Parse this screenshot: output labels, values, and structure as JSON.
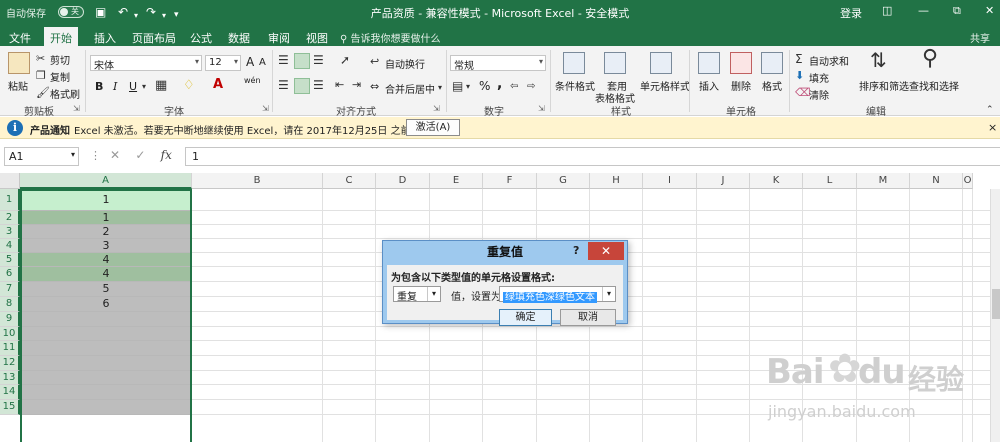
{
  "titlebar": {
    "autosave": "自动保存",
    "toggle": "关",
    "title": "产品资质 - 兼容性模式 - Microsoft Excel - 安全模式",
    "login": "登录",
    "save_icon": "save-icon",
    "undo_icon": "undo-icon",
    "redo_icon": "redo-icon"
  },
  "tabs": {
    "file": "文件",
    "items": [
      "开始",
      "插入",
      "页面布局",
      "公式",
      "数据",
      "审阅",
      "视图"
    ],
    "tellme": "告诉我你想要做什么",
    "share": "共享"
  },
  "ribbon": {
    "clipboard": {
      "paste": "粘贴",
      "cut": "剪切",
      "copy": "复制",
      "painter": "格式刷",
      "label": "剪贴板"
    },
    "font": {
      "name": "宋体",
      "size": "12",
      "bold": "B",
      "italic": "I",
      "underline": "U",
      "label": "字体",
      "grow": "A",
      "shrink": "A",
      "wen": "wén"
    },
    "alignment": {
      "wrap": "自动换行",
      "merge": "合并后居中",
      "label": "对齐方式"
    },
    "number": {
      "format": "常规",
      "percent": "%",
      "comma": ",",
      "label": "数字"
    },
    "styles": {
      "conditional": "条件格式",
      "table1": "套用",
      "table2": "表格格式",
      "cell": "单元格样式",
      "label": "样式"
    },
    "cells": {
      "insert": "插入",
      "delete": "删除",
      "format": "格式",
      "label": "单元格"
    },
    "editing": {
      "autosum": "自动求和",
      "fill": "填充",
      "clear": "清除",
      "sort": "排序和筛选",
      "find": "查找和选择",
      "label": "编辑"
    }
  },
  "notify": {
    "label": "产品通知",
    "message": "Excel 未激活。若要无中断地继续使用 Excel，请在 2017年12月25日 之前激活。",
    "button": "激活(A)",
    "close": "×"
  },
  "formula": {
    "namebox": "A1",
    "value": "1",
    "fx": "fx"
  },
  "grid": {
    "columns": [
      "A",
      "B",
      "C",
      "D",
      "E",
      "F",
      "G",
      "H",
      "I",
      "J",
      "K",
      "L",
      "M",
      "N",
      "O"
    ],
    "rows": [
      "1",
      "2",
      "3",
      "4",
      "5",
      "6",
      "7",
      "8",
      "9",
      "10",
      "11",
      "12",
      "13",
      "14",
      "15"
    ],
    "colA": [
      "1",
      "1",
      "2",
      "3",
      "4",
      "4",
      "5",
      "6",
      "",
      "",
      "",
      "",
      "",
      "",
      ""
    ]
  },
  "dialog": {
    "title": "重复值",
    "help": "?",
    "prompt": "为包含以下类型值的单元格设置格式:",
    "type": "重复",
    "mid": "值，设置为",
    "format": "绿填充色深绿色文本",
    "ok": "确定",
    "cancel": "取消"
  },
  "watermark": {
    "logo": "Bai",
    "logo2": "du",
    "cn": "经验",
    "url": "jingyan.baidu.com"
  },
  "colors": {
    "excel_green": "#217346",
    "dup_fill": "#9fbf9f",
    "selected_fill": "#bdbdbd",
    "header_fill": "#c6efce"
  }
}
